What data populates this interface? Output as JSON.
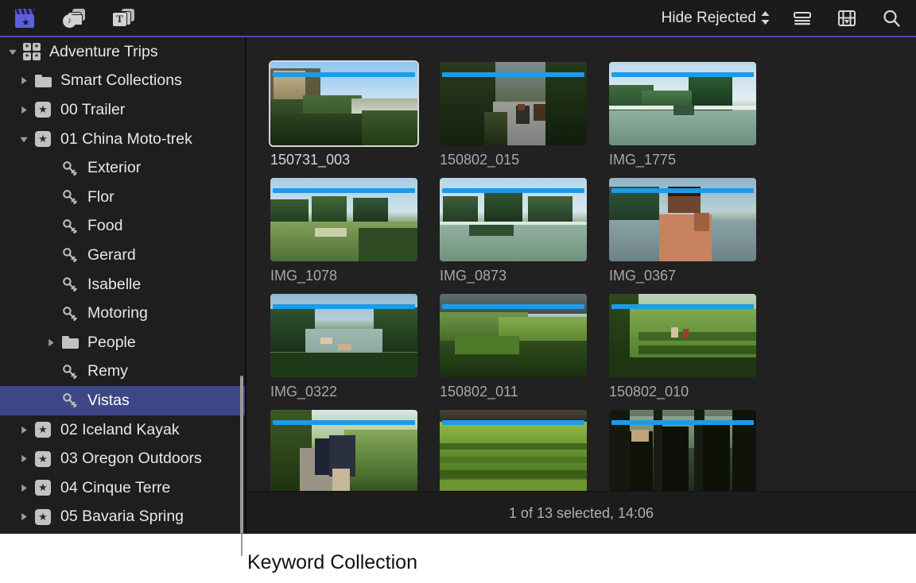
{
  "toolbar": {
    "left_buttons": [
      {
        "name": "libraries-icon",
        "label": "Libraries"
      },
      {
        "name": "photos-audio-icon",
        "label": "Photos and Audio"
      },
      {
        "name": "titles-generators-icon",
        "label": "Titles and Generators",
        "glyph": "T"
      }
    ],
    "filter_label": "Hide Rejected",
    "right_buttons": [
      {
        "name": "list-view-icon",
        "label": "List View"
      },
      {
        "name": "filmstrip-view-icon",
        "label": "Filmstrip View"
      },
      {
        "name": "search-icon",
        "label": "Search"
      }
    ]
  },
  "sidebar": {
    "items": [
      {
        "label": "Adventure Trips",
        "icon": "library-icon",
        "indent": 0,
        "disclosure": "open",
        "selected": false
      },
      {
        "label": "Smart Collections",
        "icon": "folder-icon",
        "indent": 1,
        "disclosure": "closed",
        "selected": false
      },
      {
        "label": "00 Trailer",
        "icon": "event-icon",
        "indent": 1,
        "disclosure": "closed",
        "selected": false
      },
      {
        "label": "01 China Moto-trek",
        "icon": "event-icon",
        "indent": 1,
        "disclosure": "open",
        "selected": false
      },
      {
        "label": "Exterior",
        "icon": "keyword-icon",
        "indent": 2,
        "disclosure": "none",
        "selected": false
      },
      {
        "label": "Flor",
        "icon": "keyword-icon",
        "indent": 2,
        "disclosure": "none",
        "selected": false
      },
      {
        "label": "Food",
        "icon": "keyword-icon",
        "indent": 2,
        "disclosure": "none",
        "selected": false
      },
      {
        "label": "Gerard",
        "icon": "keyword-icon",
        "indent": 2,
        "disclosure": "none",
        "selected": false
      },
      {
        "label": "Isabelle",
        "icon": "keyword-icon",
        "indent": 2,
        "disclosure": "none",
        "selected": false
      },
      {
        "label": "Motoring",
        "icon": "keyword-icon",
        "indent": 2,
        "disclosure": "none",
        "selected": false
      },
      {
        "label": "People",
        "icon": "folder-icon",
        "indent": 2,
        "disclosure": "closed",
        "selected": false
      },
      {
        "label": "Remy",
        "icon": "keyword-icon",
        "indent": 2,
        "disclosure": "none",
        "selected": false
      },
      {
        "label": "Vistas",
        "icon": "keyword-icon",
        "indent": 2,
        "disclosure": "none",
        "selected": true
      },
      {
        "label": "02 Iceland Kayak",
        "icon": "event-icon",
        "indent": 1,
        "disclosure": "closed",
        "selected": false
      },
      {
        "label": "03 Oregon Outdoors",
        "icon": "event-icon",
        "indent": 1,
        "disclosure": "closed",
        "selected": false
      },
      {
        "label": "04 Cinque Terre",
        "icon": "event-icon",
        "indent": 1,
        "disclosure": "closed",
        "selected": false
      },
      {
        "label": "05 Bavaria Spring",
        "icon": "event-icon",
        "indent": 1,
        "disclosure": "closed",
        "selected": false
      }
    ]
  },
  "browser": {
    "clips": [
      {
        "name": "150731_003",
        "selected": true,
        "scene": "cliff-valley"
      },
      {
        "name": "150802_015",
        "selected": false,
        "scene": "forest-road-motorcycles"
      },
      {
        "name": "IMG_1775",
        "selected": false,
        "scene": "river-karst"
      },
      {
        "name": "IMG_1078",
        "selected": false,
        "scene": "karst-fields"
      },
      {
        "name": "IMG_0873",
        "selected": false,
        "scene": "karst-river-reflection"
      },
      {
        "name": "IMG_0367",
        "selected": false,
        "scene": "man-portrait-boat"
      },
      {
        "name": "IMG_0322",
        "selected": false,
        "scene": "river-boats-aerial"
      },
      {
        "name": "150802_011",
        "selected": false,
        "scene": "green-hills"
      },
      {
        "name": "150802_010",
        "selected": false,
        "scene": "terraces-hikers"
      },
      {
        "name": "",
        "selected": false,
        "scene": "trail-hikers"
      },
      {
        "name": "",
        "selected": false,
        "scene": "rice-terraces"
      },
      {
        "name": "",
        "selected": false,
        "scene": "silhouette-people"
      }
    ]
  },
  "status": {
    "text": "1 of 13 selected, 14:06"
  },
  "callout": {
    "label": "Keyword Collection"
  },
  "colors": {
    "selection_blue": "#3e4786",
    "keyword_bar_blue": "#1e9ae8",
    "accent_line": "#4a49b8",
    "sidebar_bg": "#1e1e1e",
    "browser_bg": "#212121",
    "toolbar_bg": "#1b1b1b"
  }
}
